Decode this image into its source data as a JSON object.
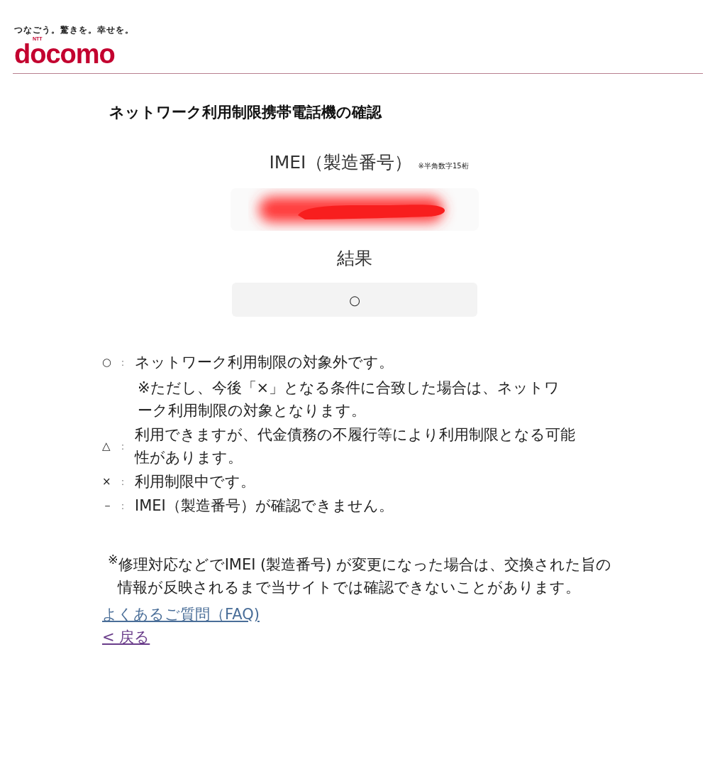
{
  "header": {
    "tagline": "つなごう。驚きを。幸せを。",
    "brand_small": "NTT",
    "brand": "docomo"
  },
  "title": "ネットワーク利用制限携帯電話機の確認",
  "imei": {
    "label": "IMEI（製造番号）",
    "hint": "※半角数字15桁",
    "redacted": true
  },
  "result": {
    "label": "結果",
    "value": "○"
  },
  "legend": [
    {
      "symbol": "○",
      "sep": "：",
      "text": "ネットワーク利用制限の対象外です。",
      "note": "※ただし、今後「×」となる条件に合致した場合は、ネットワーク利用制限の対象となります。"
    },
    {
      "symbol": "△",
      "sep": "：",
      "text": "利用できますが、代金債務の不履行等により利用制限となる可能性があります。"
    },
    {
      "symbol": "×",
      "sep": "：",
      "text": "利用制限中です。"
    },
    {
      "symbol": "－",
      "sep": "：",
      "text": "IMEI（製造番号）が確認できません。"
    }
  ],
  "footnote": "$^{※}$修理対応などでIMEI (製造番号) が変更になった場合は、交換された旨の情報が反映されるまで当サイトでは確認できないことがあります。",
  "links": [
    {
      "label": "よくあるご質問（FAQ)",
      "visited": false
    },
    {
      "label": "< 戻る",
      "visited": true
    }
  ]
}
